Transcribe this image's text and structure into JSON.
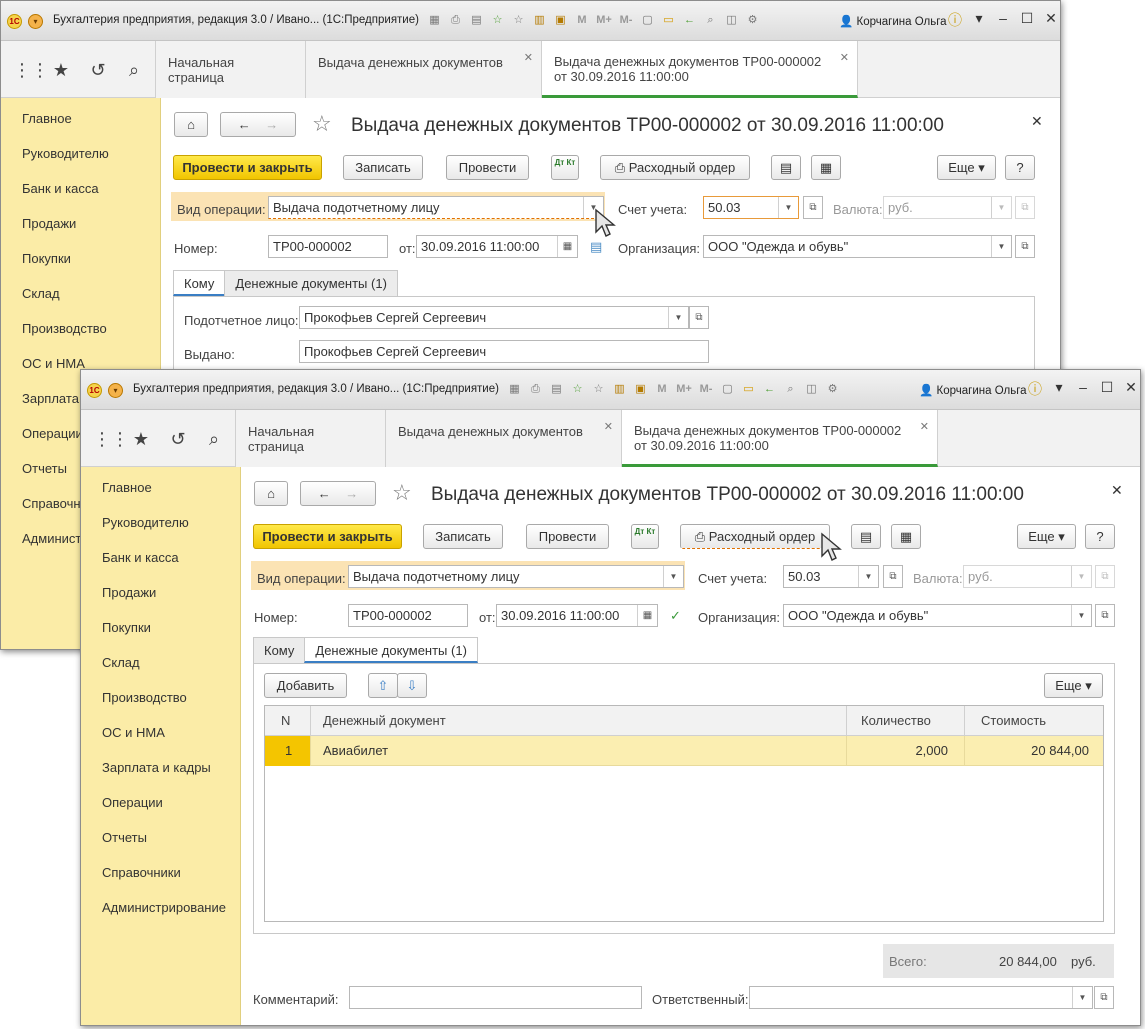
{
  "app": {
    "title": "Бухгалтерия предприятия, редакция 3.0 / Ивано...  (1С:Предприятие)",
    "logo_text": "1С",
    "user": "Корчагина Ольга",
    "toolbar_icons": [
      "save-icon",
      "print-icon",
      "preview-icon",
      "favorites-add-icon",
      "favorites-icon",
      "calculator-icon",
      "calendar-icon",
      "m-label",
      "m-plus-label",
      "m-minus-label",
      "new-window-icon",
      "open-icon",
      "back-icon",
      "search-icon",
      "panels-icon",
      "settings-icon"
    ],
    "m_labels": [
      "M",
      "M+",
      "M-"
    ]
  },
  "nav": {
    "quick_icons": [
      "apps-grid-icon",
      "star-icon",
      "history-icon",
      "search-icon"
    ],
    "tabs": [
      {
        "label": "Начальная страница"
      },
      {
        "label": "Выдача денежных документов"
      },
      {
        "label": "Выдача денежных документов ТР00-000002",
        "label2": "от 30.09.2016 11:00:00"
      }
    ]
  },
  "sidebar": {
    "items": [
      "Главное",
      "Руководителю",
      "Банк и касса",
      "Продажи",
      "Покупки",
      "Склад",
      "Производство",
      "ОС и НМА",
      "Зарплата и кадры",
      "Операции",
      "Отчеты",
      "Справочники",
      "Администрирование"
    ],
    "items_truncated": [
      "Главное",
      "Руководителю",
      "Банк и касса",
      "Продажи",
      "Покупки",
      "Склад",
      "Производство",
      "ОС и НМА",
      "Зарплата",
      "Операции",
      "Отчеты",
      "Справочн",
      "Админист"
    ]
  },
  "form": {
    "title": "Выдача денежных документов ТР00-000002 от 30.09.2016 11:00:00",
    "buttons": {
      "post_close": "Провести и закрыть",
      "write": "Записать",
      "post": "Провести",
      "dtkt": "Дт Кт",
      "cash_order": "Расходный ордер",
      "more": "Еще",
      "help": "?"
    },
    "operation_label": "Вид операции:",
    "operation_value": "Выдача подотчетному лицу",
    "account_label": "Счет учета:",
    "account_value": "50.03",
    "currency_label": "Валюта:",
    "currency_value": "руб.",
    "number_label": "Номер:",
    "number_value": "ТР00-000002",
    "date_label": "от:",
    "date_value": "30.09.2016 11:00:00",
    "org_label": "Организация:",
    "org_value": "ООО \"Одежда и обувь\"",
    "tabs": [
      "Кому",
      "Денежные документы (1)"
    ],
    "accountable_label": "Подотчетное лицо:",
    "accountable_value": "Прокофьев Сергей Сергеевич",
    "issued_label": "Выдано:",
    "issued_value": "Прокофьев Сергей Сергеевич",
    "add_button": "Добавить",
    "table": {
      "headers": [
        "N",
        "Денежный документ",
        "Количество",
        "Стоимость"
      ],
      "rows": [
        {
          "n": "1",
          "doc": "Авиабилет",
          "qty": "2,000",
          "cost": "20 844,00"
        }
      ]
    },
    "total_label": "Всего:",
    "total_value": "20 844,00",
    "total_currency": "руб.",
    "comment_label": "Комментарий:",
    "responsible_label": "Ответственный:"
  },
  "colors": {
    "sidebar_bg": "#fbeca7",
    "primary_button": "#f1c500",
    "active_tab_underline": "#3a9a3a",
    "selected_row": "#fbeeb1"
  }
}
